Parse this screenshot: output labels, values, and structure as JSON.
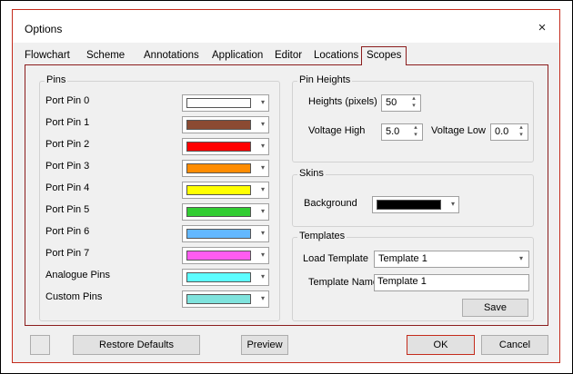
{
  "window": {
    "title": "Options",
    "close_glyph": "×"
  },
  "tabs": [
    {
      "label": "Flowchart"
    },
    {
      "label": "Scheme"
    },
    {
      "label": "Annotations"
    },
    {
      "label": "Application"
    },
    {
      "label": "Editor"
    },
    {
      "label": "Locations"
    },
    {
      "label": "Scopes",
      "active": true
    }
  ],
  "pins": {
    "title": "Pins",
    "items": [
      {
        "label": "Port Pin 0",
        "color": "#ffffff"
      },
      {
        "label": "Port Pin 1",
        "color": "#8b4a32"
      },
      {
        "label": "Port Pin 2",
        "color": "#ff0000"
      },
      {
        "label": "Port Pin 3",
        "color": "#ff8c00"
      },
      {
        "label": "Port Pin 4",
        "color": "#ffff00"
      },
      {
        "label": "Port Pin 5",
        "color": "#32cd32"
      },
      {
        "label": "Port Pin 6",
        "color": "#63b8ff"
      },
      {
        "label": "Port Pin 7",
        "color": "#ff5cf0"
      },
      {
        "label": "Analogue Pins",
        "color": "#5cfdff"
      },
      {
        "label": "Custom Pins",
        "color": "#7fe3dd"
      }
    ]
  },
  "pin_heights": {
    "title": "Pin Heights",
    "heights_label": "Heights (pixels)",
    "heights_value": "50",
    "voltage_high_label": "Voltage High",
    "voltage_high_value": "5.0",
    "voltage_low_label": "Voltage Low",
    "voltage_low_value": "0.0"
  },
  "skins": {
    "title": "Skins",
    "background_label": "Background",
    "background_color": "#000000"
  },
  "templates": {
    "title": "Templates",
    "load_label": "Load Template",
    "load_value": "Template 1",
    "name_label": "Template Name",
    "name_value": "Template 1",
    "save_label": "Save"
  },
  "footer": {
    "restore_label": "Restore Defaults",
    "preview_label": "Preview",
    "ok_label": "OK",
    "cancel_label": "Cancel"
  },
  "icons": {
    "dropdown": "chevron-down-icon",
    "spin": "spin-updown-icon",
    "close": "close-icon",
    "grip": "resize-grip-icon"
  },
  "glyphs": {
    "dropdown": "▾",
    "spin_up": "▴",
    "spin_down": "▾"
  }
}
